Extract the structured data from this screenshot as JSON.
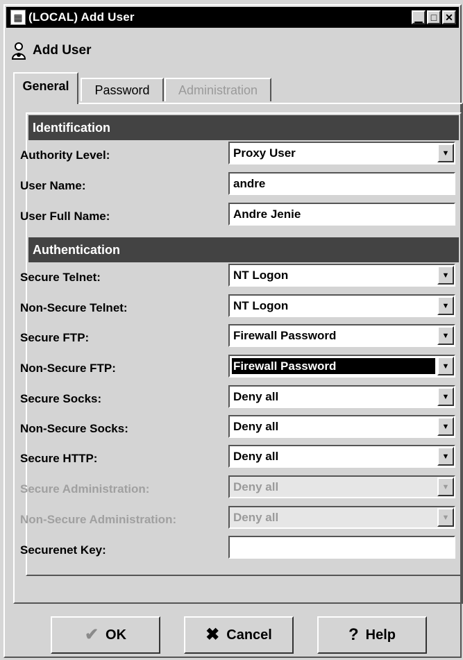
{
  "window": {
    "title": "(LOCAL) Add User",
    "controls": [
      "minimize-icon",
      "maximize-icon",
      "close-icon"
    ]
  },
  "header": {
    "title": "Add User",
    "icon": "user-icon"
  },
  "tabs": [
    {
      "label": "General",
      "state": "active"
    },
    {
      "label": "Password",
      "state": "normal"
    },
    {
      "label": "Administration",
      "state": "disabled"
    }
  ],
  "sections": {
    "identification": "Identification",
    "authentication": "Authentication"
  },
  "fields": {
    "authority_level": {
      "label": "Authority Level:",
      "value": "Proxy User"
    },
    "user_name": {
      "label": "User Name:",
      "value": "andre"
    },
    "user_full_name": {
      "label": "User Full Name:",
      "value": "Andre Jenie"
    },
    "secure_telnet": {
      "label": "Secure Telnet:",
      "value": "NT Logon"
    },
    "non_secure_telnet": {
      "label": "Non-Secure Telnet:",
      "value": "NT Logon"
    },
    "secure_ftp": {
      "label": "Secure FTP:",
      "value": "Firewall Password"
    },
    "non_secure_ftp": {
      "label": "Non-Secure FTP:",
      "value": "Firewall Password"
    },
    "secure_socks": {
      "label": "Secure Socks:",
      "value": "Deny all"
    },
    "non_secure_socks": {
      "label": "Non-Secure Socks:",
      "value": "Deny all"
    },
    "secure_http": {
      "label": "Secure HTTP:",
      "value": "Deny all"
    },
    "secure_administration": {
      "label": "Secure Administration:",
      "value": "Deny all"
    },
    "non_secure_administration": {
      "label": "Non-Secure Administration:",
      "value": "Deny all"
    },
    "securenet_key": {
      "label": "Securenet Key:",
      "value": ""
    }
  },
  "buttons": {
    "ok": {
      "label": "OK",
      "icon": "checkmark-icon"
    },
    "cancel": {
      "label": "Cancel",
      "icon": "x-icon"
    },
    "help": {
      "label": "Help",
      "icon": "question-icon"
    }
  },
  "colors": {
    "section_header": "#434343",
    "window_bg": "#d4d4d4",
    "title_bar": "#000000",
    "selected_field": "#000000"
  }
}
